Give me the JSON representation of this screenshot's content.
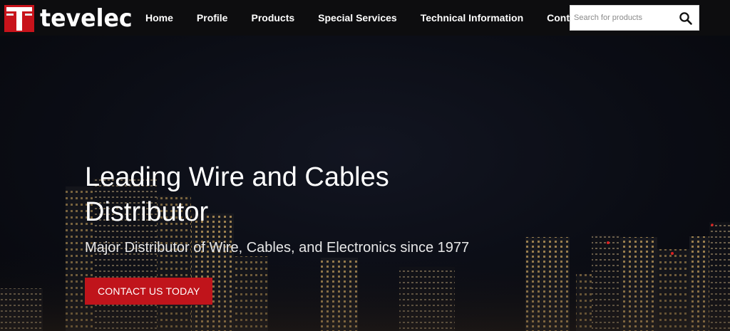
{
  "brand": {
    "name": "tevelec",
    "logo_icon": "tevelec-t-logo",
    "accent": "#c0141b"
  },
  "nav": {
    "items": [
      {
        "label": "Home"
      },
      {
        "label": "Profile"
      },
      {
        "label": "Products"
      },
      {
        "label": "Special Services"
      },
      {
        "label": "Technical Information"
      },
      {
        "label": "Contact Us"
      }
    ]
  },
  "search": {
    "placeholder": "Search for products",
    "value": "",
    "icon": "search-icon"
  },
  "hero": {
    "title": "Leading Wire and Cables Distributor",
    "subtitle": "Major Distributor of Wire, Cables, and Electronics since 1977",
    "cta_label": "CONTACT US TODAY",
    "background": "night-city-skyline"
  }
}
